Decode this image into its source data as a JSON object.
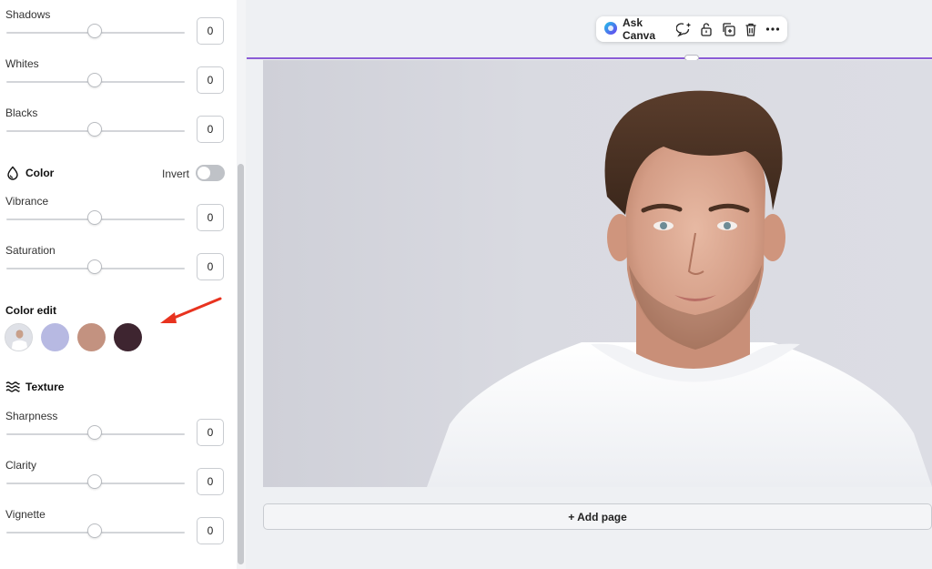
{
  "panel": {
    "sliders_top": [
      {
        "label": "Shadows",
        "value": "0"
      },
      {
        "label": "Whites",
        "value": "0"
      },
      {
        "label": "Blacks",
        "value": "0"
      }
    ],
    "color_section": {
      "title": "Color",
      "invert_label": "Invert",
      "invert_on": false
    },
    "sliders_color": [
      {
        "label": "Vibrance",
        "value": "0"
      },
      {
        "label": "Saturation",
        "value": "0"
      }
    ],
    "color_edit": {
      "title": "Color edit",
      "swatches": [
        "photo-thumbnail",
        "#b7b9e2",
        "#c39280",
        "#3e2530"
      ]
    },
    "texture_section": {
      "title": "Texture"
    },
    "sliders_texture": [
      {
        "label": "Sharpness",
        "value": "0"
      },
      {
        "label": "Clarity",
        "value": "0"
      },
      {
        "label": "Vignette",
        "value": "0"
      }
    ]
  },
  "toolbar": {
    "ask_canva_label": "Ask Canva",
    "icons": [
      "comment-add-icon",
      "lock-icon",
      "duplicate-icon",
      "trash-icon",
      "more-icon"
    ]
  },
  "canvas": {
    "add_page_label": "+ Add page",
    "selection_color": "#8b5cd6"
  },
  "annotation": {
    "arrow_color": "#e8331f"
  }
}
